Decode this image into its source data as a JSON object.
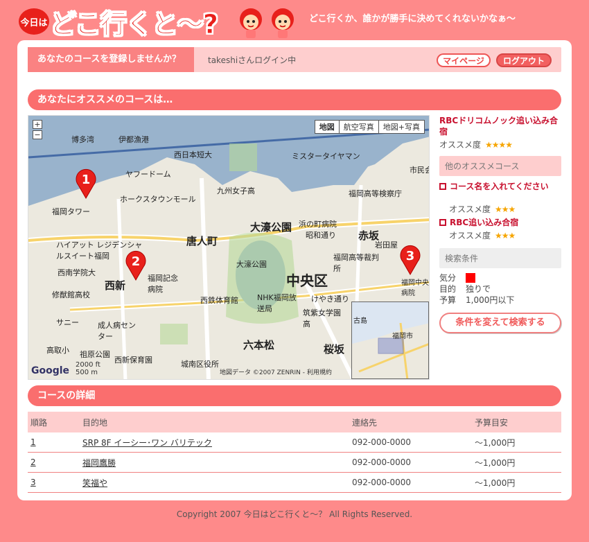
{
  "header": {
    "badge": "今日は",
    "logo": "どこ行くと〜?",
    "tagline": "どこ行くか、誰かが勝手に決めてくれないかなぁ〜"
  },
  "topbar": {
    "label": "あなたのコースを登録しませんか？",
    "user_status": "takeshiさんログイン中",
    "mypage_label": "マイページ",
    "logout_label": "ログアウト"
  },
  "recommend": {
    "section_title": "あなたにオススメのコースは…",
    "map": {
      "types": [
        "地図",
        "航空写真",
        "地図+写真"
      ],
      "zoom_in": "+",
      "zoom_out": "−",
      "pins": [
        "1",
        "2",
        "3"
      ],
      "labels": [
        "博多湾",
        "伊都漁港",
        "西日本短大",
        "ミスタータイヤマン",
        "ヤフードーム",
        "九州女子高",
        "福岡高等検察庁",
        "ホークスタウンモール",
        "福岡タワー",
        "大濠公園",
        "浜の町病院",
        "昭和通り",
        "唐人町",
        "赤坂",
        "ハイアット レジデンシャルスイート福岡",
        "西南学院大",
        "大濠公園",
        "中央区",
        "西新",
        "福岡記念病院",
        "NHK福岡放送局",
        "けやき通り",
        "修猷館高校",
        "西鉄体育館",
        "筑紫女学園高",
        "サニー",
        "成人病センター",
        "六本松",
        "桜坂",
        "高取小",
        "祖原公園",
        "西新保育園",
        "城南区役所",
        "福岡中央病院",
        "福岡高等裁判所",
        "岩田屋",
        "市民会",
        "古島",
        "福岡市"
      ],
      "scale_top": "2000 ft",
      "scale_bottom": "500 m",
      "attribution": "地図データ ©2007 ZENRIN - 利用規約",
      "google": "Google"
    },
    "course_title": "RBCドリコムノック追い込み合宿",
    "rating_label": "オススメ度",
    "rating_stars": "★★★★",
    "others_title": "他のオススメコース",
    "others": [
      {
        "name": "コース名を入れてください",
        "rating_label": "オススメ度",
        "stars": "★★★"
      },
      {
        "name": "RBC追い込み合宿",
        "rating_label": "オススメ度",
        "stars": "★★★"
      }
    ],
    "conditions_title": "検索条件",
    "conditions": {
      "mood_label": "気分",
      "mood_color": "#ff0000",
      "purpose_label": "目的",
      "purpose_value": "独りで",
      "budget_label": "予算",
      "budget_value": "1,000円以下"
    },
    "search_button": "条件を変えて検索する"
  },
  "details": {
    "section_title": "コースの詳細",
    "columns": [
      "順路",
      "目的地",
      "連絡先",
      "予算目安"
    ],
    "rows": [
      {
        "order": "1",
        "place": "SRP 8F イーシー･ワン バリテック",
        "tel": "092-000-0000",
        "budget": "〜1,000円"
      },
      {
        "order": "2",
        "place": "福岡鷹勝",
        "tel": "092-000-0000",
        "budget": "〜1,000円"
      },
      {
        "order": "3",
        "place": "笑福や",
        "tel": "092-000-0000",
        "budget": "〜1,000円"
      }
    ]
  },
  "footer": "Copyright 2007 今日はどこ行くと〜？ All Rights Reserved.",
  "colors": {
    "brand": "#e8201b",
    "accent": "#fa6e6e",
    "bg": "#fe8a8a"
  }
}
